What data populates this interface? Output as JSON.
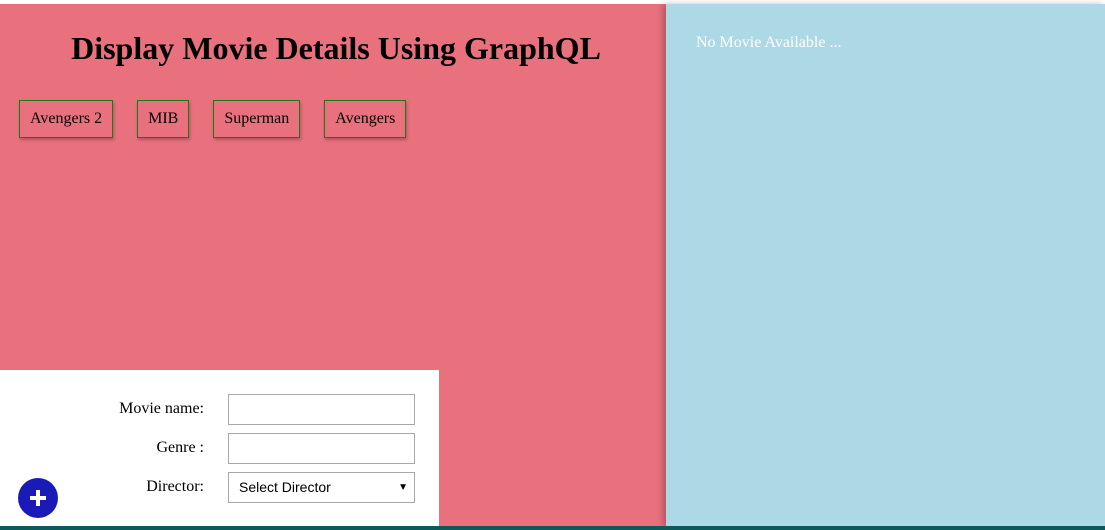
{
  "header": {
    "title": "Display Movie Details Using GraphQL"
  },
  "movies": [
    {
      "label": "Avengers 2"
    },
    {
      "label": "MIB"
    },
    {
      "label": "Superman"
    },
    {
      "label": "Avengers"
    }
  ],
  "details": {
    "empty_text": "No Movie Available ..."
  },
  "form": {
    "movie_name_label": "Movie name:",
    "movie_name_value": "",
    "genre_label": "Genre :",
    "genre_value": "",
    "director_label": "Director:",
    "director_selected": "Select Director"
  },
  "add_button": {
    "icon": "plus-icon"
  },
  "colors": {
    "main_bg": "#e8717d",
    "side_bg": "#add8e6",
    "button_border": "#1a7a1a",
    "add_button": "#1a1ab8",
    "bottom_bar": "#0e5a5a"
  }
}
